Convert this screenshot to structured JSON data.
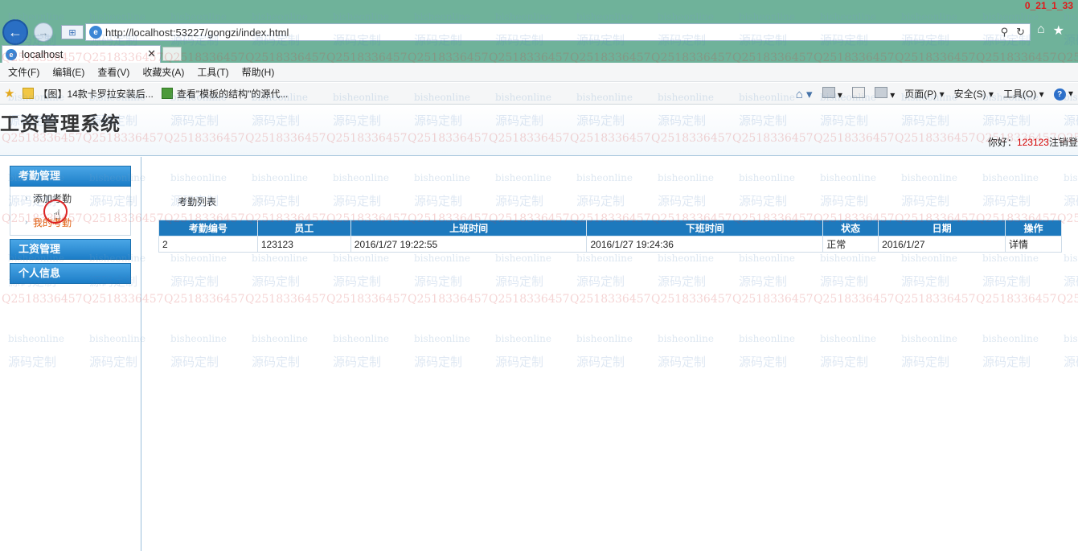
{
  "browser": {
    "url": "http://localhost:53227/gongzi/index.html",
    "tab_title": "localhost",
    "timer": "0_21_1_33",
    "menu": [
      "文件(F)",
      "编辑(E)",
      "查看(V)",
      "收藏夹(A)",
      "工具(T)",
      "帮助(H)"
    ],
    "favorites": [
      "【图】14款卡罗拉安装后...",
      "查看\"模板的结构\"的源代..."
    ],
    "commands": [
      "页面(P)",
      "安全(S)",
      "工具(O)"
    ]
  },
  "header": {
    "title": "工资管理系统",
    "greeting": "你好：",
    "username": "123123",
    "logout": "注销登"
  },
  "sidebar": {
    "groups": [
      {
        "label": "考勤管理",
        "items": [
          "添加考勤",
          "我的考勤"
        ]
      },
      {
        "label": "工资管理"
      },
      {
        "label": "个人信息"
      }
    ]
  },
  "content": {
    "list_title": "考勤列表",
    "columns": [
      "考勤编号",
      "员工",
      "上班时间",
      "下班时间",
      "状态",
      "日期",
      "操作"
    ],
    "rows": [
      [
        "2",
        "123123",
        "2016/1/27 19:22:55",
        "2016/1/27 19:24:36",
        "正常",
        "2016/1/27",
        "详情"
      ]
    ]
  },
  "watermark": [
    "bisheonline",
    "源码定制",
    "Q2518336457"
  ]
}
